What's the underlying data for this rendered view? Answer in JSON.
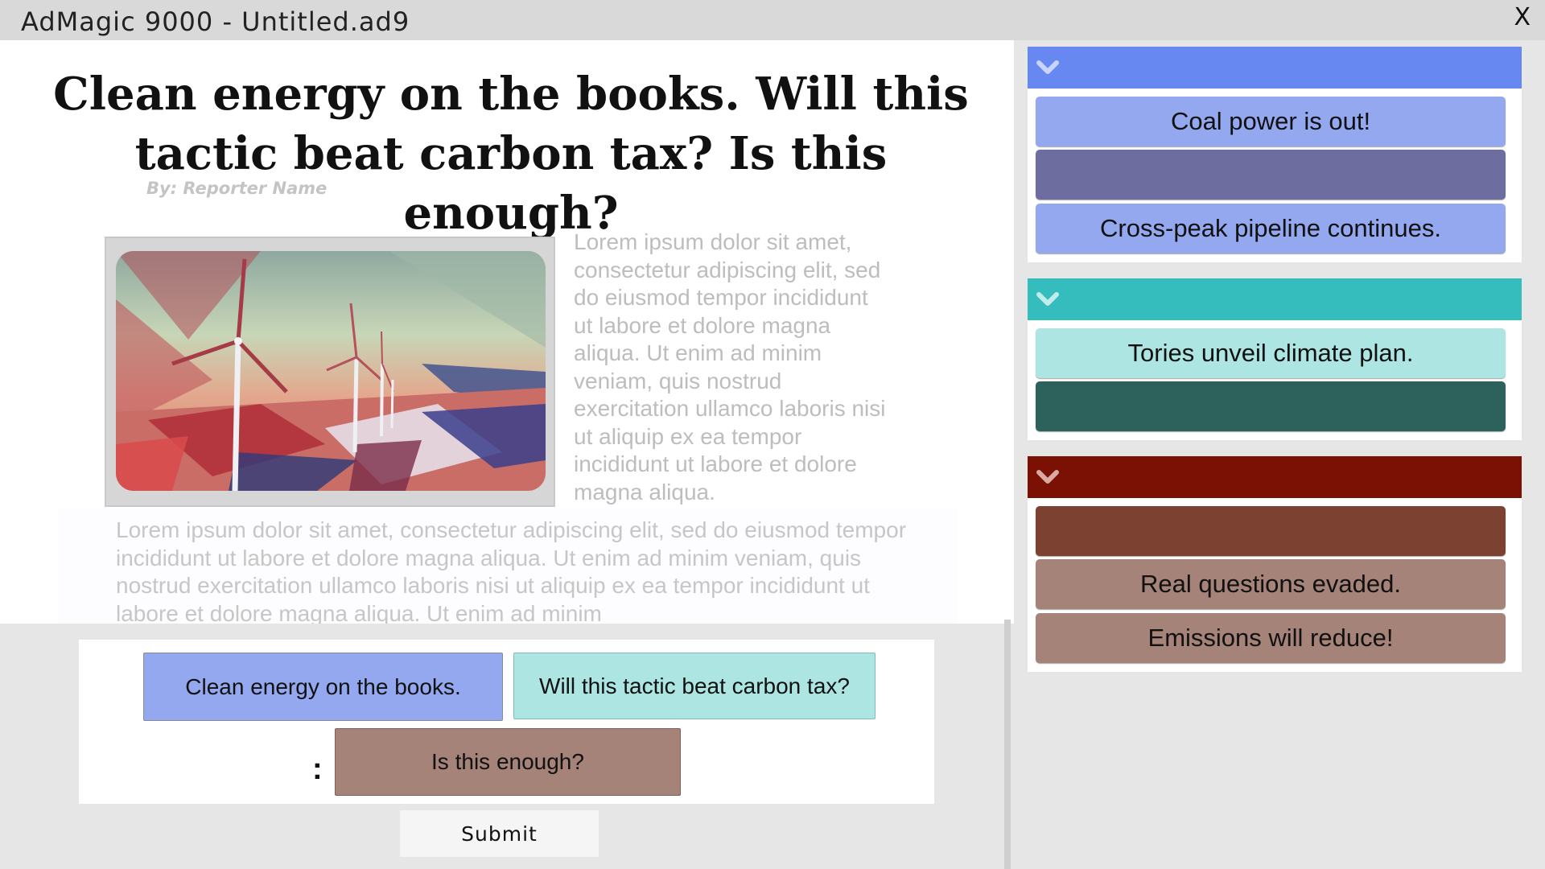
{
  "window": {
    "title": "AdMagic 9000 - Untitled.ad9",
    "close_label": "X"
  },
  "article": {
    "headline_line1": "Clean energy on the books.  Will this",
    "headline_line2": "tactic beat carbon tax?  Is this enough?",
    "byline": "By: Reporter Name",
    "image_icon": "wind-turbines-image",
    "side_text": "Lorem ipsum dolor sit amet, consectetur adipiscing elit, sed do eiusmod tempor incididunt ut labore et dolore magna aliqua. Ut enim ad minim veniam, quis nostrud exercitation ullamco laboris nisi ut aliquip ex ea tempor incididunt ut labore et dolore magna aliqua.",
    "body_text": "Lorem ipsum dolor sit amet, consectetur adipiscing elit, sed do eiusmod tempor incididunt ut labore et dolore magna aliqua. Ut enim ad minim veniam, quis nostrud exercitation ullamco laboris nisi ut aliquip ex ea tempor incididunt ut labore et dolore magna aliqua. Ut enim ad minim"
  },
  "answer": {
    "chips": [
      {
        "label": "Clean energy on the books.",
        "color": "#94a8f0"
      },
      {
        "label": "Will this tactic beat carbon tax?",
        "color": "#ace5e2"
      },
      {
        "label": "Is this enough?",
        "color": "#a58378"
      }
    ],
    "separator": ":"
  },
  "submit_label": "Submit",
  "groups": [
    {
      "header_color": "#6788f0",
      "chevron_icon": "chevron-down-icon",
      "items": [
        {
          "label": "Coal power is out!",
          "color": "#94a8f0"
        },
        {
          "label": "",
          "color": "#6e6d9f"
        },
        {
          "label": "Cross-peak pipeline continues.",
          "color": "#94a8f0"
        }
      ]
    },
    {
      "header_color": "#35bcbd",
      "chevron_icon": "chevron-down-icon",
      "items": [
        {
          "label": "Tories unveil climate plan.",
          "color": "#ace5e2"
        },
        {
          "label": "",
          "color": "#2c625b"
        }
      ]
    },
    {
      "header_color": "#7a1104",
      "chevron_icon": "chevron-down-icon",
      "items": [
        {
          "label": "",
          "color": "#7d4132"
        },
        {
          "label": "Real questions evaded.",
          "color": "#a58378"
        },
        {
          "label": "Emissions will reduce!",
          "color": "#a58378"
        }
      ]
    }
  ]
}
